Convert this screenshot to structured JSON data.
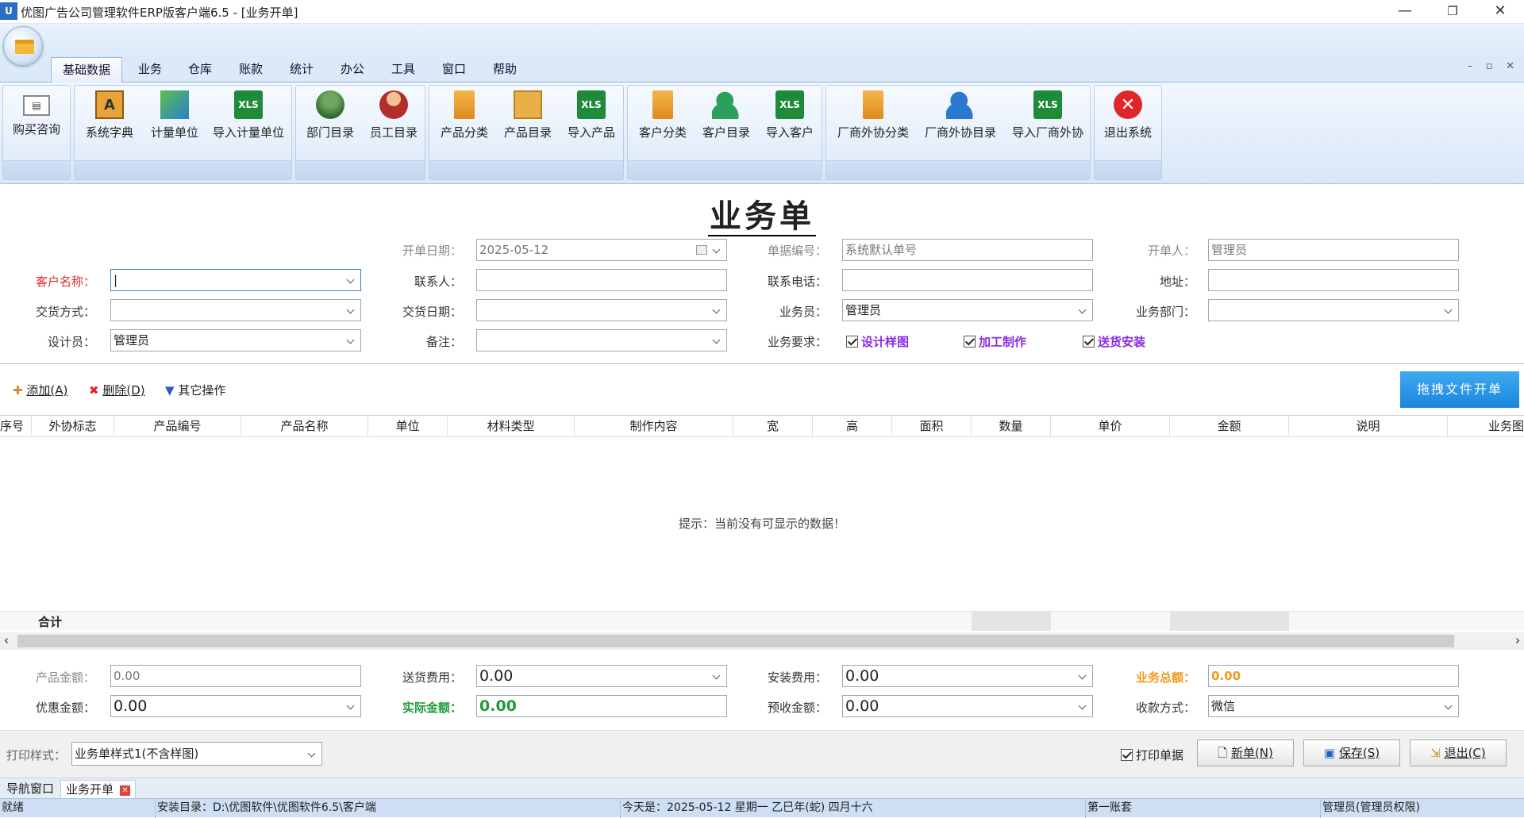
{
  "window": {
    "title": "优图广告公司管理软件ERP版客户端6.5 - [业务开单]",
    "app_icon_text": "U"
  },
  "menu_tabs": [
    {
      "label": "基础数据"
    },
    {
      "label": "业务"
    },
    {
      "label": "仓库"
    },
    {
      "label": "账款"
    },
    {
      "label": "统计"
    },
    {
      "label": "办公"
    },
    {
      "label": "工具"
    },
    {
      "label": "窗口"
    },
    {
      "label": "帮助"
    }
  ],
  "toolbar": [
    {
      "label": "购买咨询",
      "icon": "contact-card-icon"
    },
    {
      "label": "系统字典",
      "icon": "dictionary-book-icon"
    },
    {
      "label": "计量单位",
      "icon": "stairs-icon"
    },
    {
      "label": "导入计量单位",
      "icon": "xls-icon"
    },
    {
      "label": "部门目录",
      "icon": "department-people-icon"
    },
    {
      "label": "员工目录",
      "icon": "employee-icon"
    },
    {
      "label": "产品分类",
      "icon": "tree-category-icon"
    },
    {
      "label": "产品目录",
      "icon": "boxes-icon"
    },
    {
      "label": "导入产品",
      "icon": "xls-icon"
    },
    {
      "label": "客户分类",
      "icon": "tree-category-icon"
    },
    {
      "label": "客户目录",
      "icon": "add-person-green-icon"
    },
    {
      "label": "导入客户",
      "icon": "xls-icon"
    },
    {
      "label": "厂商外协分类",
      "icon": "tree-category-icon"
    },
    {
      "label": "厂商外协目录",
      "icon": "add-person-blue-icon"
    },
    {
      "label": "导入厂商外协",
      "icon": "xls-icon"
    },
    {
      "label": "退出系统",
      "icon": "exit-icon"
    }
  ],
  "form": {
    "title": "业务单",
    "open_date": {
      "label": "开单日期：",
      "value": "2025-05-12"
    },
    "doc_no": {
      "label": "单据编号：",
      "placeholder": "系统默认单号"
    },
    "creator": {
      "label": "开单人：",
      "value": "管理员"
    },
    "customer": {
      "label": "客户名称：",
      "value": ""
    },
    "contact": {
      "label": "联系人：",
      "value": ""
    },
    "phone": {
      "label": "联系电话：",
      "value": ""
    },
    "address": {
      "label": "地址：",
      "value": ""
    },
    "delivery_method": {
      "label": "交货方式：",
      "value": ""
    },
    "delivery_date": {
      "label": "交货日期：",
      "value": ""
    },
    "salesperson": {
      "label": "业务员：",
      "value": "管理员"
    },
    "department": {
      "label": "业务部门：",
      "value": ""
    },
    "designer": {
      "label": "设计员：",
      "value": "管理员"
    },
    "remark": {
      "label": "备注：",
      "value": ""
    },
    "requirements": {
      "label": "业务要求：",
      "options": [
        {
          "label": "设计样图",
          "color": "#8a2be2",
          "checked": true
        },
        {
          "label": "加工制作",
          "color": "#8a2be2",
          "checked": true
        },
        {
          "label": "送货安装",
          "color": "#8a2be2",
          "checked": true
        }
      ]
    }
  },
  "actions": {
    "add": "添加(A)",
    "delete": "删除(D)",
    "other": "其它操作",
    "drag_open": "拖拽文件开单"
  },
  "grid": {
    "columns": [
      "序号",
      "外协标志",
      "产品编号",
      "产品名称",
      "单位",
      "材料类型",
      "制作内容",
      "宽",
      "高",
      "面积",
      "数量",
      "单价",
      "金额",
      "说明",
      "业务图"
    ],
    "empty_hint": "提示：当前没有可显示的数据！",
    "sum_label": "合计"
  },
  "totals": {
    "product_amount": {
      "label": "产品金额：",
      "value": "0.00"
    },
    "delivery_fee": {
      "label": "送货费用：",
      "value": "0.00"
    },
    "install_fee": {
      "label": "安装费用：",
      "value": "0.00"
    },
    "business_total": {
      "label": "业务总额：",
      "value": "0.00"
    },
    "discount": {
      "label": "优惠金额：",
      "value": "0.00"
    },
    "actual_amount": {
      "label": "实际金额：",
      "value": "0.00"
    },
    "prepaid": {
      "label": "预收金额：",
      "value": "0.00"
    },
    "payment_method": {
      "label": "收款方式：",
      "value": "微信"
    }
  },
  "bottom": {
    "print_style_label": "打印样式：",
    "print_style_value": "业务单样式1(不含样图)",
    "print_doc": "打印单据",
    "new_btn": "新单(N)",
    "save_btn": "保存(S)",
    "exit_btn": "退出(C)"
  },
  "doc_tabs": [
    {
      "label": "导航窗口"
    },
    {
      "label": "业务开单"
    }
  ],
  "status": {
    "ready": "就绪",
    "install_dir": "安装目录：D:\\优图软件\\优图软件6.5\\客户端",
    "today": "今天是：2025-05-12 星期一 乙巳年(蛇) 四月十六",
    "account": "第一账套",
    "user": "管理员(管理员权限)"
  }
}
